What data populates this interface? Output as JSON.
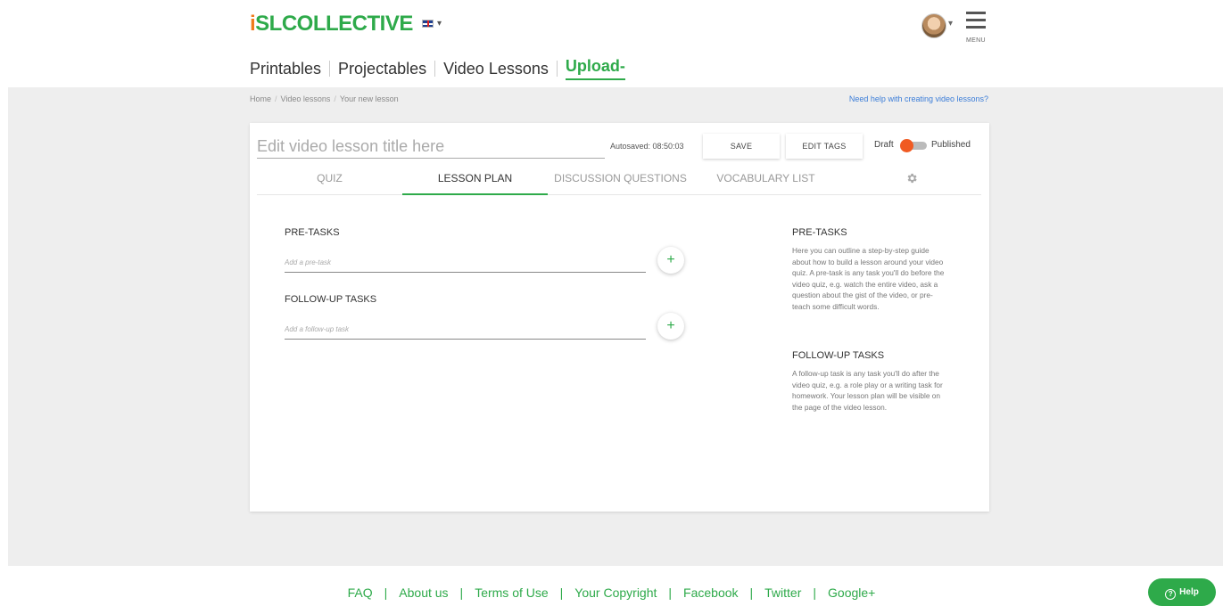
{
  "header": {
    "logo_prefix": "i",
    "logo_text": "SLCOLLECTIVE",
    "flag_icon": "uk-flag-icon",
    "menu_label": "MENU"
  },
  "topnav": {
    "items": [
      "Printables",
      "Projectables",
      "Video Lessons"
    ],
    "upload": "Upload",
    "upload_caret": "-"
  },
  "breadcrumb": {
    "items": [
      "Home",
      "Video lessons",
      "Your new lesson"
    ],
    "help_link": "Need help with creating video lessons?"
  },
  "editor": {
    "title_placeholder": "Edit video lesson title here",
    "autosaved": "Autosaved: 08:50:03",
    "save_label": "SAVE",
    "edit_tags_label": "EDIT TAGS",
    "draft_label": "Draft",
    "published_label": "Published",
    "status": "Draft",
    "accent_color": "#2eaa4a",
    "toggle_color": "#f05a22"
  },
  "tabs": {
    "items": [
      "QUIZ",
      "LESSON PLAN",
      "DISCUSSION QUESTIONS",
      "VOCABULARY LIST"
    ],
    "active": "LESSON PLAN",
    "settings_icon": "gear-icon"
  },
  "lesson_plan": {
    "pre_tasks_label": "PRE-TASKS",
    "pre_task_placeholder": "Add a pre-task",
    "follow_up_label": "FOLLOW-UP TASKS",
    "follow_up_placeholder": "Add a follow-up task",
    "add_symbol": "+"
  },
  "sidebar_help": {
    "pre_tasks_title": "PRE-TASKS",
    "pre_tasks_text": "Here you can outline a step-by-step guide about how to build a lesson around your video quiz. A pre-task is any task you'll do before the video quiz, e.g. watch the entire video, ask a question about the gist of the video, or pre-teach some difficult words.",
    "follow_up_title": "FOLLOW-UP TASKS",
    "follow_up_text": "A follow-up task is any task you'll do after the video quiz, e.g. a role play or a writing task for homework. Your lesson plan will be visible on the page of the video lesson."
  },
  "footer": {
    "links": [
      "FAQ",
      "About us",
      "Terms of Use",
      "Your Copyright",
      "Facebook",
      "Twitter",
      "Google+"
    ],
    "help_button": "Help"
  }
}
